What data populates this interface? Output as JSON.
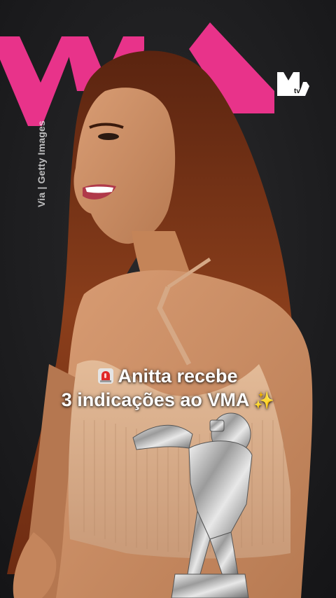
{
  "photo": {
    "subject": "Anitta on the red carpet holding a VMA moon person trophy",
    "backdrop_accent": "#e8338a",
    "hair_color": "#7a3416",
    "skin_color": "#c98a62",
    "dress_color": "#d8ae8a"
  },
  "credit": {
    "text": "Via | Getty Images"
  },
  "logo": {
    "name": "mtv-logo",
    "color": "#ffffff"
  },
  "caption": {
    "line1": "Anitta recebe",
    "line2": "3 indicações ao VMA",
    "leading_icon": "siren-emoji",
    "trailing_icon": "sparkles-emoji"
  }
}
